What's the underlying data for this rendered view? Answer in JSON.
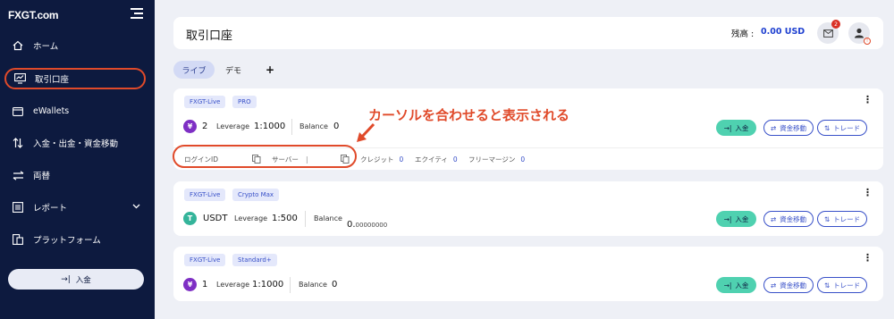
{
  "sidebar": {
    "logo": "FXGT.com",
    "items": [
      {
        "label": "ホーム",
        "icon": "home-icon"
      },
      {
        "label": "取引口座",
        "icon": "chart-monitor-icon"
      },
      {
        "label": "eWallets",
        "icon": "wallet-icon"
      },
      {
        "label": "入金・出金・資金移動",
        "icon": "transfer-vertical-icon"
      },
      {
        "label": "両替",
        "icon": "exchange-icon"
      },
      {
        "label": "レポート",
        "icon": "report-icon"
      },
      {
        "label": "プラットフォーム",
        "icon": "platform-icon"
      }
    ],
    "deposit_button": "入金"
  },
  "header": {
    "title": "取引口座",
    "balance_label": "残高 :",
    "balance_value": "0.00 USD",
    "notification_count": "2",
    "user_badge": "!"
  },
  "tabs": {
    "live": "ライブ",
    "demo": "デモ",
    "add": "+"
  },
  "accounts": [
    {
      "tags": [
        "FXGT-Live",
        "PRO"
      ],
      "currency_symbol": "¥",
      "number": "2",
      "leverage_label": "Leverage",
      "leverage": "1:1000",
      "balance_label": "Balance",
      "balance": "0",
      "sub": {
        "login_label": "ログインID",
        "server_label": "サーバー",
        "server_value": "|",
        "credit_label": "クレジット",
        "credit_value": "0",
        "equity_label": "エクイティ",
        "equity_value": "0",
        "free_margin_label": "フリーマージン",
        "free_margin_value": "0"
      }
    },
    {
      "tags": [
        "FXGT-Live",
        "Crypto Max"
      ],
      "currency_symbol": "T",
      "number": "USDT",
      "leverage_label": "Leverage",
      "leverage": "1:500",
      "balance_label": "Balance",
      "balance_main": "0.",
      "balance_decimals": "00000000"
    },
    {
      "tags": [
        "FXGT-Live",
        "Standard+"
      ],
      "currency_symbol": "¥",
      "number": "1",
      "leverage_label": "Leverage",
      "leverage": "1:1000",
      "balance_label": "Balance",
      "balance": "0"
    }
  ],
  "buttons": {
    "deposit": "入金",
    "transfer": "資金移動",
    "trade": "トレード"
  },
  "annotation": "カーソルを合わせると表示される",
  "colors": {
    "sidebar_bg": "#0d1a3f",
    "accent": "#3850c8",
    "highlight": "#e04a2a",
    "deposit_btn": "#4fd1b0"
  }
}
